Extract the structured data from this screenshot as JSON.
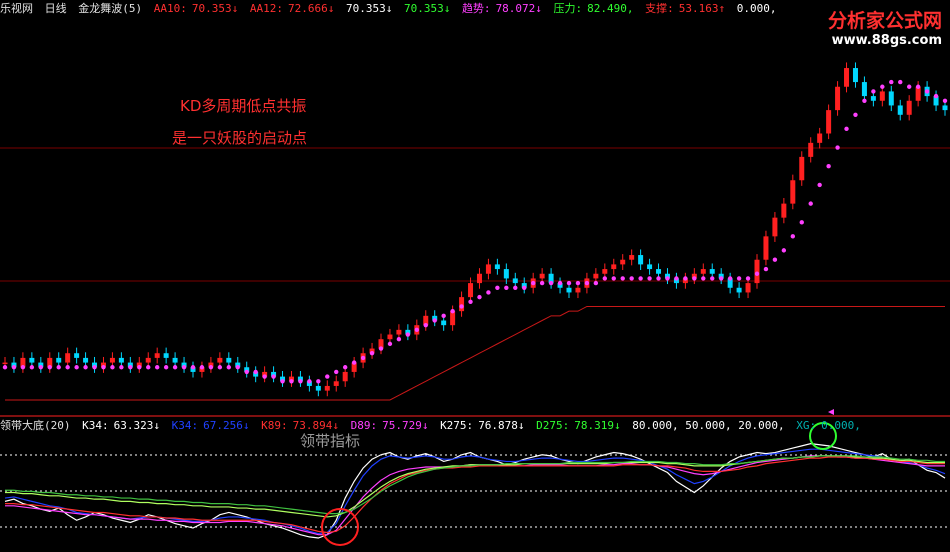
{
  "header": {
    "app_name": "乐视网",
    "period": "日线",
    "indicator": "金龙舞波(5)",
    "aa10_label": "AA10:",
    "aa10_value": "70.353↓",
    "aa12_label": "AA12:",
    "aa12_value": "72.666↓",
    "v1": "70.353↓",
    "v2": "70.353↓",
    "trend_label": "趋势:",
    "trend_value": "78.072↓",
    "pressure_label": "压力:",
    "pressure_value": "82.490,",
    "support_label": "支撑:",
    "support_value": "53.163↑",
    "extra": "0.000,"
  },
  "watermark": {
    "title": "分析家公式网",
    "url": "www.88gs.com"
  },
  "annotation": {
    "line1": "KD多周期低点共振",
    "line2": "是一只妖股的启动点"
  },
  "lower_header": {
    "name": "领带大底(20)",
    "k34_label": "K34:",
    "k34": "63.323↓",
    "k34b_label": "K34:",
    "k34b": "67.256↓",
    "k89_label": "K89:",
    "k89": "73.894↓",
    "d89_label": "D89:",
    "d89": "75.729↓",
    "k275_label": "K275:",
    "k275": "76.878↓",
    "d275_label": "D275:",
    "d275": "78.319↓",
    "levels": "80.000,  50.000,  20.000,",
    "xg_label": "XG:",
    "xg": "0.000,"
  },
  "lower_title": "领带指标",
  "chart_data": [
    {
      "type": "candlestick",
      "title": "",
      "series": [
        {
          "name": "close",
          "values": [
            41,
            40,
            42,
            41,
            40,
            42,
            41,
            43,
            42,
            41,
            40,
            41,
            42,
            41,
            40,
            41,
            42,
            43,
            42,
            41,
            40,
            39,
            40,
            41,
            42,
            41,
            40,
            39,
            38,
            39,
            38,
            37,
            38,
            37,
            36,
            35,
            36,
            37,
            39,
            41,
            43,
            44,
            46,
            47,
            48,
            47,
            49,
            51,
            50,
            49,
            52,
            55,
            58,
            60,
            62,
            61,
            59,
            58,
            57,
            59,
            60,
            58,
            57,
            56,
            57,
            59,
            60,
            61,
            62,
            63,
            64,
            62,
            61,
            60,
            59,
            58,
            59,
            60,
            61,
            60,
            59,
            57,
            56,
            58,
            63,
            68,
            72,
            75,
            80,
            85,
            88,
            90,
            95,
            100,
            104,
            101,
            98,
            97,
            99,
            96,
            94,
            97,
            100,
            98,
            96,
            95
          ]
        },
        {
          "name": "support",
          "values": [
            33,
            33,
            33,
            33,
            33,
            33,
            33,
            33,
            33,
            33,
            33,
            33,
            33,
            33,
            33,
            33,
            33,
            33,
            33,
            33,
            33,
            33,
            33,
            33,
            33,
            33,
            33,
            33,
            33,
            33,
            33,
            33,
            33,
            33,
            33,
            33,
            33,
            33,
            33,
            33,
            33,
            33,
            33,
            33,
            34,
            35,
            36,
            37,
            38,
            39,
            40,
            41,
            42,
            43,
            44,
            45,
            46,
            47,
            48,
            49,
            50,
            51,
            51,
            52,
            52,
            53,
            53,
            53,
            53,
            53,
            53,
            53,
            53,
            53,
            53,
            53,
            53,
            53,
            53,
            53,
            53,
            53,
            53,
            53,
            53,
            53,
            53,
            53,
            53,
            53,
            53,
            53,
            53,
            53,
            53,
            53,
            53,
            53,
            53,
            53,
            53,
            53,
            53,
            53,
            53,
            53
          ]
        },
        {
          "name": "trend_dots",
          "values": [
            40,
            40,
            40,
            40,
            40,
            40,
            40,
            40,
            40,
            40,
            40,
            40,
            40,
            40,
            40,
            40,
            40,
            40,
            40,
            40,
            40,
            40,
            40,
            40,
            40,
            40,
            40,
            39,
            39,
            38,
            38,
            37,
            37,
            37,
            37,
            37,
            38,
            39,
            40,
            41,
            42,
            43,
            44,
            45,
            46,
            47,
            48,
            49,
            50,
            51,
            52,
            53,
            54,
            55,
            56,
            57,
            57,
            57,
            57,
            58,
            58,
            58,
            58,
            58,
            58,
            58,
            58,
            59,
            59,
            59,
            59,
            59,
            59,
            59,
            59,
            59,
            59,
            59,
            59,
            59,
            59,
            59,
            59,
            59,
            60,
            61,
            63,
            65,
            68,
            71,
            75,
            79,
            83,
            87,
            91,
            94,
            97,
            99,
            100,
            101,
            101,
            100,
            100,
            99,
            98,
            97
          ]
        }
      ]
    },
    {
      "type": "line",
      "title": "领带大底(20)",
      "ylim": [
        0,
        100
      ],
      "series": [
        {
          "name": "K34",
          "values": [
            42,
            44,
            40,
            38,
            35,
            33,
            36,
            30,
            25,
            28,
            32,
            30,
            27,
            25,
            23,
            26,
            30,
            28,
            25,
            22,
            20,
            18,
            22,
            25,
            30,
            32,
            30,
            28,
            25,
            22,
            20,
            18,
            15,
            12,
            10,
            9,
            12,
            25,
            45,
            60,
            72,
            80,
            84,
            86,
            82,
            80,
            83,
            85,
            82,
            78,
            80,
            84,
            86,
            82,
            80,
            78,
            75,
            77,
            80,
            82,
            84,
            83,
            80,
            78,
            76,
            79,
            82,
            84,
            86,
            85,
            83,
            80,
            76,
            72,
            68,
            60,
            55,
            50,
            56,
            64,
            72,
            78,
            82,
            84,
            86,
            85,
            86,
            88,
            90,
            92,
            94,
            93,
            92,
            90,
            88,
            86,
            84,
            82,
            85,
            80,
            78,
            80,
            75,
            70,
            68,
            63
          ]
        },
        {
          "name": "K34b",
          "values": [
            45,
            46,
            44,
            42,
            40,
            38,
            37,
            35,
            32,
            31,
            30,
            29,
            28,
            27,
            26,
            27,
            28,
            28,
            27,
            26,
            25,
            24,
            24,
            25,
            27,
            28,
            28,
            27,
            26,
            25,
            23,
            22,
            20,
            18,
            15,
            13,
            14,
            22,
            38,
            52,
            65,
            74,
            80,
            83,
            82,
            81,
            82,
            83,
            82,
            80,
            80,
            82,
            83,
            82,
            80,
            79,
            78,
            78,
            79,
            80,
            81,
            81,
            80,
            79,
            78,
            78,
            79,
            80,
            81,
            81,
            80,
            79,
            77,
            74,
            71,
            66,
            62,
            58,
            60,
            64,
            69,
            74,
            78,
            81,
            83,
            84,
            85,
            86,
            87,
            88,
            89,
            89,
            88,
            87,
            86,
            85,
            84,
            83,
            82,
            80,
            78,
            77,
            75,
            72,
            70,
            67
          ]
        },
        {
          "name": "K89",
          "values": [
            38,
            38,
            37,
            36,
            35,
            34,
            33,
            32,
            31,
            30,
            30,
            29,
            28,
            27,
            26,
            26,
            26,
            25,
            25,
            24,
            24,
            23,
            23,
            23,
            23,
            24,
            24,
            24,
            23,
            22,
            21,
            20,
            18,
            16,
            14,
            12,
            12,
            16,
            26,
            36,
            46,
            54,
            61,
            66,
            69,
            71,
            72,
            73,
            73,
            73,
            73,
            74,
            75,
            75,
            75,
            75,
            74,
            74,
            74,
            75,
            75,
            75,
            75,
            74,
            74,
            74,
            74,
            75,
            75,
            76,
            76,
            75,
            75,
            74,
            73,
            71,
            69,
            67,
            66,
            67,
            69,
            71,
            73,
            75,
            77,
            78,
            79,
            80,
            81,
            82,
            83,
            83,
            83,
            82,
            82,
            81,
            81,
            80,
            79,
            78,
            77,
            76,
            75,
            74,
            74,
            74
          ]
        },
        {
          "name": "D89",
          "values": [
            40,
            40,
            39,
            39,
            38,
            37,
            36,
            35,
            34,
            33,
            32,
            32,
            31,
            30,
            29,
            29,
            28,
            28,
            27,
            27,
            26,
            26,
            25,
            25,
            25,
            25,
            25,
            25,
            25,
            24,
            23,
            22,
            21,
            19,
            17,
            15,
            14,
            15,
            20,
            28,
            37,
            45,
            52,
            58,
            62,
            66,
            68,
            70,
            71,
            72,
            72,
            73,
            73,
            74,
            74,
            74,
            74,
            74,
            74,
            74,
            74,
            74,
            74,
            74,
            74,
            74,
            74,
            74,
            74,
            75,
            75,
            75,
            75,
            74,
            74,
            73,
            72,
            70,
            69,
            69,
            69,
            70,
            71,
            73,
            74,
            76,
            77,
            78,
            79,
            80,
            81,
            81,
            82,
            82,
            82,
            81,
            81,
            80,
            80,
            79,
            78,
            78,
            77,
            76,
            76,
            76
          ]
        },
        {
          "name": "K275",
          "values": [
            50,
            50,
            49,
            49,
            48,
            47,
            47,
            46,
            45,
            45,
            44,
            44,
            43,
            42,
            42,
            41,
            41,
            40,
            40,
            39,
            39,
            38,
            38,
            37,
            37,
            37,
            36,
            36,
            35,
            35,
            34,
            33,
            32,
            31,
            30,
            29,
            28,
            29,
            32,
            37,
            43,
            49,
            55,
            60,
            64,
            67,
            69,
            71,
            72,
            73,
            74,
            74,
            75,
            75,
            75,
            75,
            75,
            75,
            76,
            76,
            76,
            76,
            76,
            76,
            76,
            76,
            76,
            76,
            77,
            77,
            77,
            77,
            77,
            77,
            76,
            76,
            75,
            74,
            74,
            74,
            74,
            75,
            76,
            77,
            78,
            79,
            80,
            81,
            81,
            82,
            82,
            83,
            83,
            83,
            83,
            82,
            82,
            81,
            81,
            80,
            79,
            79,
            78,
            77,
            77,
            77
          ]
        },
        {
          "name": "D275",
          "values": [
            52,
            52,
            51,
            51,
            50,
            50,
            49,
            48,
            48,
            47,
            47,
            46,
            46,
            45,
            45,
            44,
            44,
            43,
            43,
            42,
            42,
            41,
            41,
            40,
            40,
            40,
            39,
            39,
            38,
            38,
            37,
            36,
            35,
            34,
            33,
            32,
            31,
            31,
            32,
            35,
            40,
            45,
            51,
            56,
            60,
            64,
            67,
            69,
            71,
            72,
            73,
            74,
            74,
            75,
            75,
            75,
            76,
            76,
            76,
            76,
            76,
            76,
            76,
            77,
            77,
            77,
            77,
            77,
            77,
            77,
            78,
            78,
            78,
            78,
            77,
            77,
            76,
            76,
            75,
            75,
            75,
            76,
            76,
            77,
            78,
            79,
            80,
            81,
            81,
            82,
            82,
            83,
            83,
            83,
            83,
            83,
            82,
            82,
            82,
            81,
            80,
            80,
            79,
            79,
            78,
            78
          ]
        }
      ]
    }
  ],
  "colors": {
    "up": "#ff2020",
    "down": "#00d8ff",
    "k34": "#ffffff",
    "k34b": "#2040ff",
    "k89": "#ff40ff",
    "d89": "#ff3030",
    "k275": "#b0ff60",
    "d275": "#40c040",
    "dots": "#ff40ff",
    "support": "#c81818"
  }
}
